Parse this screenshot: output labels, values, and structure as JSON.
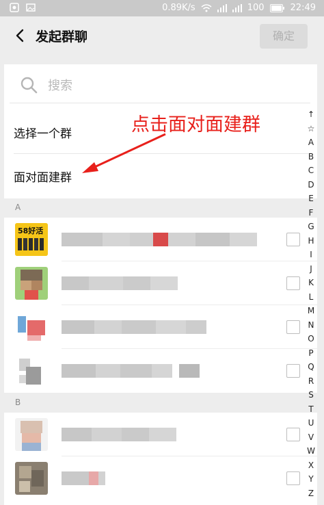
{
  "status_bar": {
    "network_speed": "0.89K/s",
    "battery": "100",
    "time": "22:49"
  },
  "header": {
    "title": "发起群聊",
    "confirm_label": "确定"
  },
  "search": {
    "placeholder": "搜索"
  },
  "menu": {
    "select_group": "选择一个群",
    "face_to_face": "面对面建群"
  },
  "annotation": {
    "text": "点击面对面建群",
    "color": "#e8201b"
  },
  "sections": [
    {
      "letter": "A"
    },
    {
      "letter": "B"
    }
  ],
  "alphabet_index": [
    "↑",
    "☆",
    "A",
    "B",
    "C",
    "D",
    "E",
    "F",
    "G",
    "H",
    "I",
    "J",
    "K",
    "L",
    "M",
    "N",
    "O",
    "P",
    "Q",
    "R",
    "S",
    "T",
    "U",
    "V",
    "W",
    "X",
    "Y",
    "Z"
  ],
  "avatar_items": {
    "a1_text": "58好活"
  },
  "colors": {
    "accent_red": "#e8201b",
    "confirm_disabled_bg": "#dcdcdc"
  }
}
